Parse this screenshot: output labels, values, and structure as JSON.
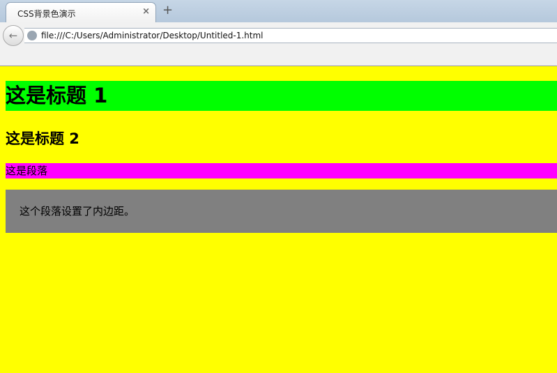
{
  "browser": {
    "tab_title": "CSS背景色演示",
    "tab_close": "×",
    "new_tab": "+",
    "back": "←",
    "url": "file:///C:/Users/Administrator/Desktop/Untitled-1.html"
  },
  "content": {
    "heading1": "这是标题 1",
    "heading2": "这是标题 2",
    "paragraph": "这是段落",
    "padded_paragraph": "这个段落设置了内边距。"
  },
  "colors": {
    "body_background": "#ffff00",
    "heading1_background": "#00ff00",
    "paragraph_background": "#ff00ff",
    "padded_paragraph_background": "#808080"
  }
}
